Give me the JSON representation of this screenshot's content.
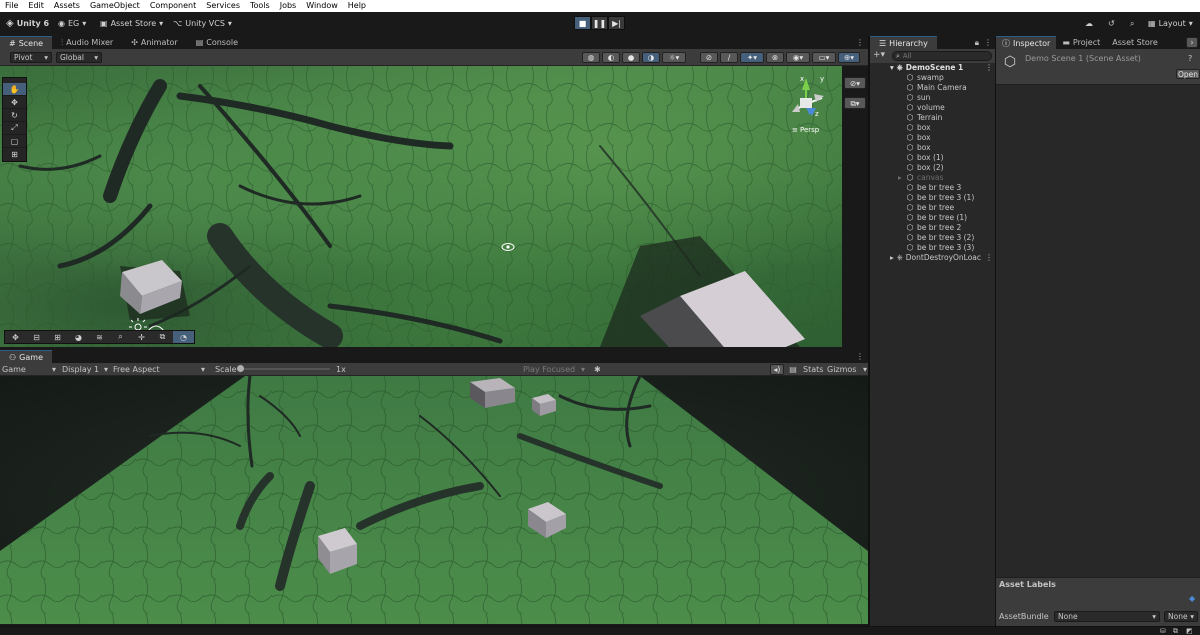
{
  "menu": [
    "File",
    "Edit",
    "Assets",
    "GameObject",
    "Component",
    "Services",
    "Tools",
    "Jobs",
    "Window",
    "Help"
  ],
  "toolbar": {
    "app_version": "Unity 6",
    "account": "EG",
    "asset_store": "Asset Store",
    "vcs": "Unity VCS",
    "layout": "Layout"
  },
  "scene_panel": {
    "tabs": [
      "Scene",
      "Audio Mixer",
      "Animator",
      "Console"
    ],
    "pivot": "Pivot",
    "space": "Global",
    "gizmo_label": "Persp",
    "axis_x": "x",
    "axis_y": "y",
    "axis_z": "z"
  },
  "game_panel": {
    "tab": "Game",
    "mode": "Game",
    "display": "Display 1",
    "aspect": "Free Aspect",
    "scale_label": "Scale",
    "scale_value": "1x",
    "play_focused": "Play Focused",
    "stats": "Stats",
    "gizmos": "Gizmos"
  },
  "hierarchy": {
    "tab": "Hierarchy",
    "search_placeholder": "All",
    "scene": "DemoScene 1",
    "items": [
      {
        "label": "swamp",
        "enabled": true
      },
      {
        "label": "Main Camera",
        "enabled": true
      },
      {
        "label": "sun",
        "enabled": true
      },
      {
        "label": "volume",
        "enabled": true
      },
      {
        "label": "Terrain",
        "enabled": true
      },
      {
        "label": "box",
        "enabled": true
      },
      {
        "label": "box",
        "enabled": true
      },
      {
        "label": "box",
        "enabled": true
      },
      {
        "label": "box (1)",
        "enabled": true
      },
      {
        "label": "box (2)",
        "enabled": true
      },
      {
        "label": "canvas",
        "enabled": false
      },
      {
        "label": "be br tree 3",
        "enabled": true
      },
      {
        "label": "be br tree 3 (1)",
        "enabled": true
      },
      {
        "label": "be br tree",
        "enabled": true
      },
      {
        "label": "be br tree (1)",
        "enabled": true
      },
      {
        "label": "be br tree 2",
        "enabled": true
      },
      {
        "label": "be br tree 3 (2)",
        "enabled": true
      },
      {
        "label": "be br tree 3 (3)",
        "enabled": true
      }
    ],
    "dont_destroy": "DontDestroyOnLoac"
  },
  "inspector": {
    "tabs": [
      "Inspector",
      "Project",
      "Asset Store"
    ],
    "asset_title": "Demo Scene 1 (Scene Asset)",
    "open_button": "Open",
    "asset_labels": "Asset Labels",
    "asset_bundle_label": "AssetBundle",
    "asset_bundle_value": "None",
    "variant_value": "None"
  },
  "colors": {
    "accent": "#46607c",
    "panel": "#282828",
    "terrain": "#4d8a4b"
  }
}
